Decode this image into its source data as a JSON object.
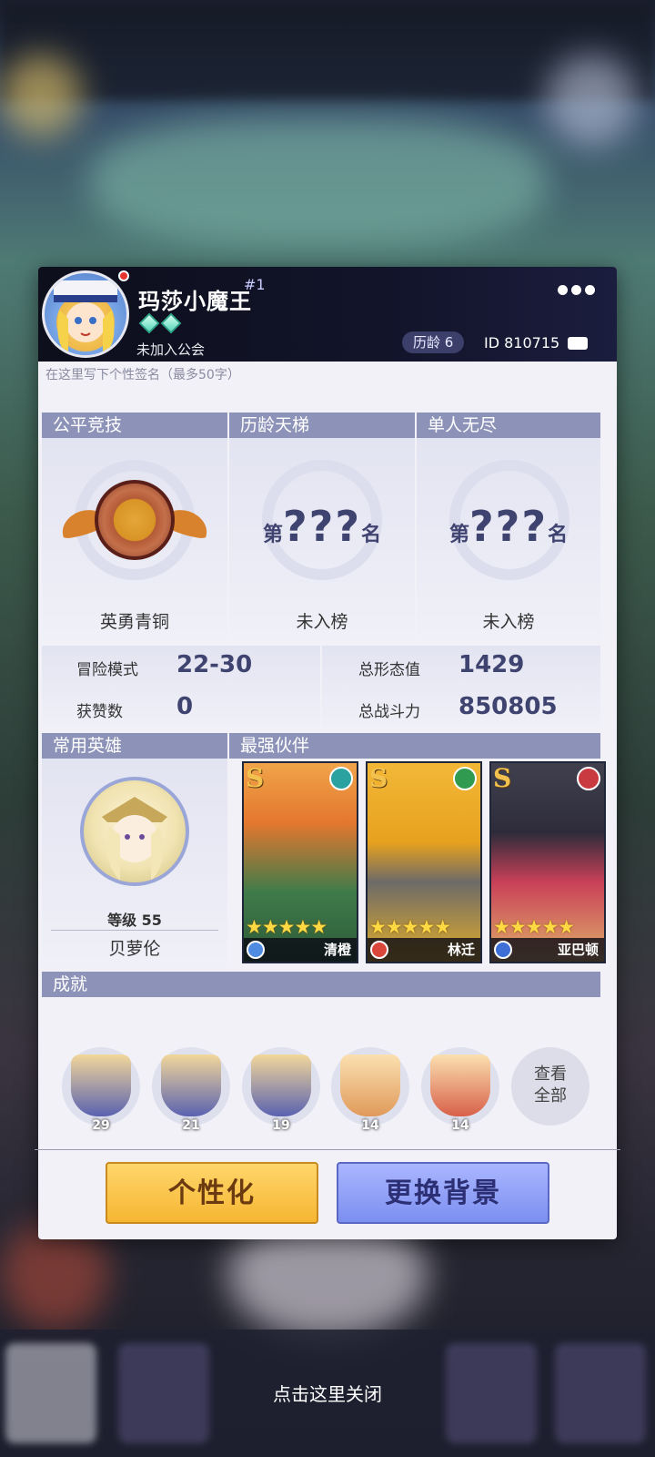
{
  "profile": {
    "name": "玛莎小魔王",
    "rank_tag": "#1",
    "guild": "未加入公会",
    "age_badge": "历龄 6",
    "id_text": "ID 810715",
    "signature_placeholder": "在这里写下个性签名（最多50字）"
  },
  "sections": {
    "fair_arena": "公平竞技",
    "ladder": "历龄天梯",
    "endless": "单人无尽",
    "common_hero": "常用英雄",
    "best_partner": "最强伙伴",
    "achievements": "成就"
  },
  "ranks": {
    "fair_arena_tier": "英勇青铜",
    "unranked_prefix": "第",
    "unranked_qs": "???",
    "unranked_suffix": "名",
    "ladder_status": "未入榜",
    "endless_status": "未入榜"
  },
  "stats": {
    "adventure_label": "冒险模式",
    "adventure_value": "22-30",
    "likes_label": "获赞数",
    "likes_value": "0",
    "form_label": "总形态值",
    "form_value": "1429",
    "power_label": "总战斗力",
    "power_value": "850805"
  },
  "hero": {
    "level": "等级 55",
    "name": "贝萝伦"
  },
  "partners": [
    {
      "grade": "S",
      "stars": "★★★★★",
      "name": "清橙"
    },
    {
      "grade": "S",
      "stars": "★★★★★",
      "name": "林迁"
    },
    {
      "grade": "S",
      "stars": "★★★★★",
      "name": "亚巴顿"
    }
  ],
  "achievements": [
    {
      "count": "29"
    },
    {
      "count": "21"
    },
    {
      "count": "19"
    },
    {
      "count": "14"
    },
    {
      "count": "14"
    }
  ],
  "view_all": {
    "line1": "查看",
    "line2": "全部"
  },
  "buttons": {
    "personalize": "个性化",
    "change_bg": "更换背景"
  },
  "close_hint": "点击这里关闭"
}
